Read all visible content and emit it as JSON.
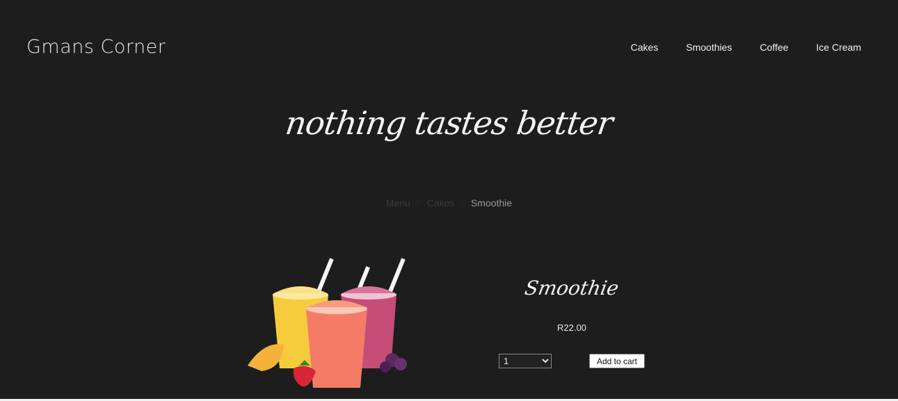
{
  "header": {
    "logo": "Gmans Corner",
    "nav": [
      "Cakes",
      "Smoothies",
      "Coffee",
      "Ice Cream"
    ]
  },
  "hero": {
    "tagline": "nothing tastes better"
  },
  "breadcrumb": {
    "items": [
      "Menu",
      "Cakes"
    ],
    "separator_icon": "heart-outline-icon",
    "current": "Smoothie"
  },
  "product": {
    "image_icon": "smoothie-cups-image",
    "title": "Smoothie",
    "price": "R22.00",
    "quantity": "1",
    "add_to_cart_label": "Add to cart"
  },
  "colors": {
    "background": "#1d1d1d",
    "text": "#f4f4f4",
    "muted": "#3b3b3b"
  }
}
